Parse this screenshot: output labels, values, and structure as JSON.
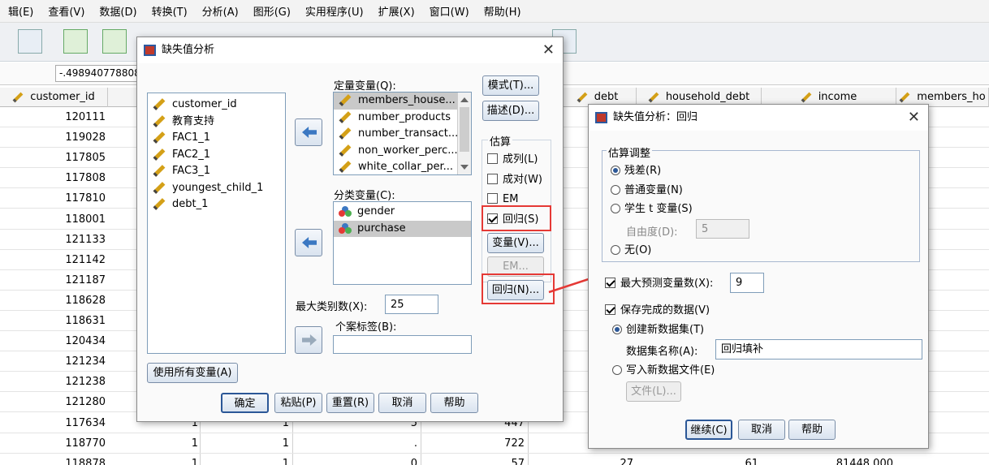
{
  "menu": [
    "辑(E)",
    "查看(V)",
    "数据(D)",
    "转换(T)",
    "分析(A)",
    "图形(G)",
    "实用程序(U)",
    "扩展(X)",
    "窗口(W)",
    "帮助(H)"
  ],
  "cell_value": "-.4989407788086",
  "columns": {
    "customer_id": "customer_id",
    "debt": "debt",
    "household_debt": "household_debt",
    "income": "income",
    "members_ho": "members_ho"
  },
  "rows": [
    {
      "id": "120111"
    },
    {
      "id": "119028"
    },
    {
      "id": "117805"
    },
    {
      "id": "117808"
    },
    {
      "id": "117810"
    },
    {
      "id": "118001"
    },
    {
      "id": "121133"
    },
    {
      "id": "121142"
    },
    {
      "id": "121187"
    },
    {
      "id": "118628"
    },
    {
      "id": "118631"
    },
    {
      "id": "120434"
    },
    {
      "id": "121234"
    },
    {
      "id": "121238"
    },
    {
      "id": "121280"
    },
    {
      "id": "117634",
      "c2": "1",
      "c3": "1",
      "c4": "5",
      "c5": "447"
    },
    {
      "id": "118770",
      "c2": "1",
      "c3": "1",
      "c4": ".",
      "c5": "722"
    },
    {
      "id": "118878",
      "c2": "1",
      "c3": "1",
      "c4": "0",
      "c5": "57",
      "debt": "27",
      "hd": "61",
      "income": "81448.000"
    }
  ],
  "missing_dialog": {
    "title": "缺失值分析",
    "source_vars": [
      "customer_id",
      "教育支持",
      "FAC1_1",
      "FAC2_1",
      "FAC3_1",
      "youngest_child_1",
      "debt_1"
    ],
    "quant_label": "定量变量(Q):",
    "quant_vars": [
      "members_house...",
      "number_products",
      "number_transact...",
      "non_worker_perc...",
      "white_collar_per..."
    ],
    "cat_label": "分类变量(C):",
    "cat_vars": [
      "gender",
      "purchase"
    ],
    "max_cat_label": "最大类别数(X):",
    "max_cat_value": "25",
    "case_label": "个案标签(B):",
    "use_all": "使用所有变量(A)",
    "btn_patterns": "模式(T)...",
    "btn_describe": "描述(D)...",
    "estimate_title": "估算",
    "est_listwise": "成列(L)",
    "est_pairwise": "成对(W)",
    "est_em": "EM",
    "est_regression": "回归(S)",
    "btn_variables": "变量(V)...",
    "btn_em": "EM...",
    "btn_regression": "回归(N)...",
    "ok": "确定",
    "paste": "粘贴(P)",
    "reset": "重置(R)",
    "cancel": "取消",
    "help": "帮助"
  },
  "regression_dialog": {
    "title": "缺失值分析：回归",
    "group_title": "估算调整",
    "opt_residual": "残差(R)",
    "opt_normal": "普通变量(N)",
    "opt_student": "学生 t 变量(S)",
    "df_label": "自由度(D):",
    "df_value": "5",
    "opt_none": "无(O)",
    "max_pred_label": "最大预测变量数(X):",
    "max_pred_value": "9",
    "save_label": "保存完成的数据(V)",
    "create_new": "创建新数据集(T)",
    "dataset_name_label": "数据集名称(A):",
    "dataset_name_value": "回归填补",
    "write_file": "写入新数据文件(E)",
    "file_btn": "文件(L)...",
    "continue": "继续(C)",
    "cancel": "取消",
    "help": "帮助"
  },
  "colors": {
    "highlight": "#e53935",
    "accent": "#2b5797"
  }
}
